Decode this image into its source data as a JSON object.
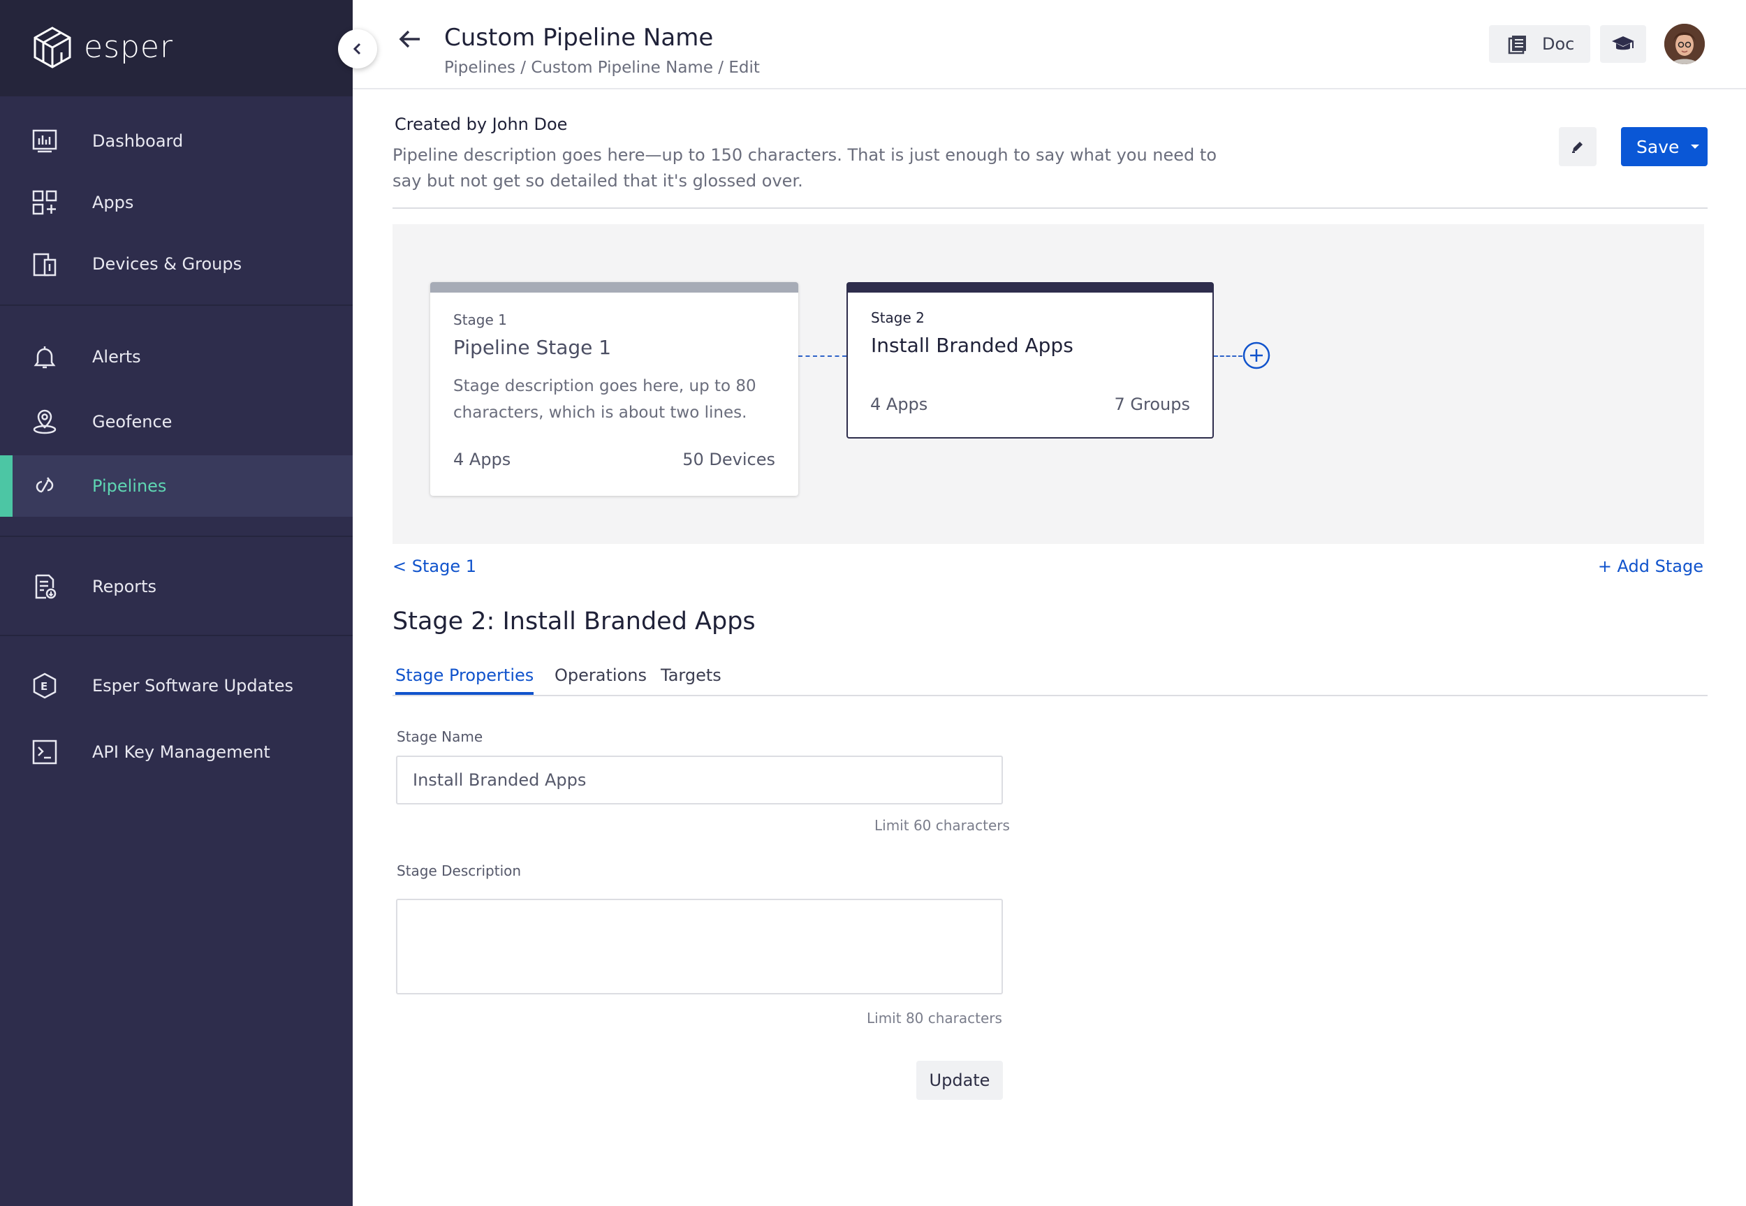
{
  "brand": {
    "name": "esper"
  },
  "sidebar": {
    "items": [
      {
        "label": "Dashboard",
        "icon": "dashboard-icon"
      },
      {
        "label": "Apps",
        "icon": "apps-icon"
      },
      {
        "label": "Devices & Groups",
        "icon": "devices-icon"
      },
      {
        "label": "Alerts",
        "icon": "bell-icon"
      },
      {
        "label": "Geofence",
        "icon": "geofence-icon"
      },
      {
        "label": "Pipelines",
        "icon": "pipelines-icon",
        "active": true
      },
      {
        "label": "Reports",
        "icon": "reports-icon"
      },
      {
        "label": "Esper Software Updates",
        "icon": "esper-updates-icon"
      },
      {
        "label": "API Key Management",
        "icon": "terminal-icon"
      }
    ],
    "active_color": "#4cc6a4"
  },
  "header": {
    "title": "Custom Pipeline Name",
    "breadcrumb": "Pipelines / Custom Pipeline Name / Edit",
    "doc_label": "Doc"
  },
  "pipeline": {
    "created_by": "Created by John Doe",
    "description": "Pipeline description goes here—up to 150 characters. That is just enough to say what you need to say but not get so detailed that it's glossed over.",
    "save_label": "Save"
  },
  "stages": [
    {
      "label": "Stage 1",
      "title": "Pipeline Stage 1",
      "description": "Stage description goes here, up to 80 characters, which is about two lines.",
      "apps": "4 Apps",
      "targets": "50 Devices"
    },
    {
      "label": "Stage 2",
      "title": "Install Branded Apps",
      "apps": "4 Apps",
      "targets": "7 Groups"
    }
  ],
  "nav_links": {
    "prev_stage": "< Stage 1",
    "add_stage": "+ Add Stage"
  },
  "stage_detail": {
    "heading": "Stage 2: Install Branded Apps",
    "tabs": [
      "Stage Properties",
      "Operations",
      "Targets"
    ],
    "active_tab": "Stage Properties",
    "name_label": "Stage Name",
    "name_value": "Install Branded Apps",
    "name_limit": "Limit 60 characters",
    "desc_label": "Stage Description",
    "desc_value": "",
    "desc_limit": "Limit 80 characters",
    "update_label": "Update"
  },
  "colors": {
    "sidebar_bg": "#2e2d4c",
    "primary": "#0a57d6",
    "link": "#1053cc"
  }
}
